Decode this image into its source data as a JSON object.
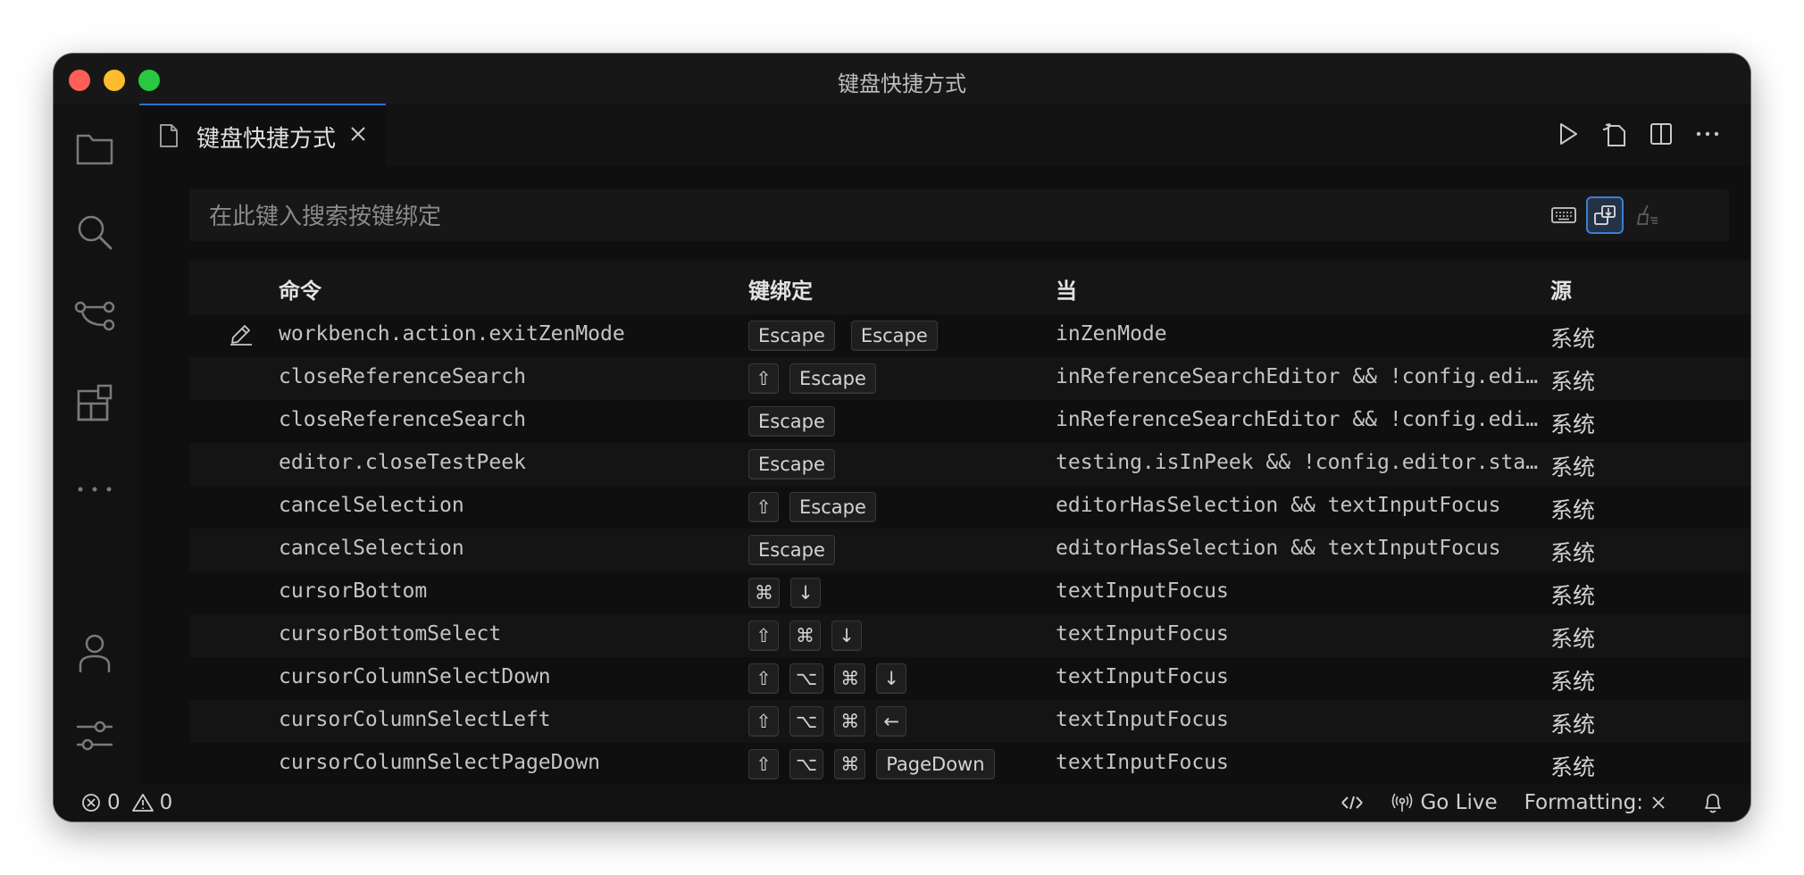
{
  "window": {
    "title": "键盘快捷方式"
  },
  "tab": {
    "label": "键盘快捷方式"
  },
  "search": {
    "placeholder": "在此键入搜索按键绑定"
  },
  "columns": {
    "command": "命令",
    "keybinding": "键绑定",
    "when": "当",
    "source": "源"
  },
  "rows": [
    {
      "command": "workbench.action.exitZenMode",
      "keys": [
        [
          "Escape"
        ],
        [
          "Escape"
        ]
      ],
      "when": "inZenMode",
      "source": "系统"
    },
    {
      "command": "closeReferenceSearch",
      "keys": [
        [
          "⇧",
          "Escape"
        ]
      ],
      "when": "inReferenceSearchEditor && !config.editor.stablePeek",
      "source": "系统"
    },
    {
      "command": "closeReferenceSearch",
      "keys": [
        [
          "Escape"
        ]
      ],
      "when": "inReferenceSearchEditor && !config.editor.stablePeek",
      "source": "系统"
    },
    {
      "command": "editor.closeTestPeek",
      "keys": [
        [
          "Escape"
        ]
      ],
      "when": "testing.isInPeek && !config.editor.stablePeek",
      "source": "系统"
    },
    {
      "command": "cancelSelection",
      "keys": [
        [
          "⇧",
          "Escape"
        ]
      ],
      "when": "editorHasSelection && textInputFocus",
      "source": "系统"
    },
    {
      "command": "cancelSelection",
      "keys": [
        [
          "Escape"
        ]
      ],
      "when": "editorHasSelection && textInputFocus",
      "source": "系统"
    },
    {
      "command": "cursorBottom",
      "keys": [
        [
          "⌘",
          "↓"
        ]
      ],
      "when": "textInputFocus",
      "source": "系统"
    },
    {
      "command": "cursorBottomSelect",
      "keys": [
        [
          "⇧",
          "⌘",
          "↓"
        ]
      ],
      "when": "textInputFocus",
      "source": "系统"
    },
    {
      "command": "cursorColumnSelectDown",
      "keys": [
        [
          "⇧",
          "⌥",
          "⌘",
          "↓"
        ]
      ],
      "when": "textInputFocus",
      "source": "系统"
    },
    {
      "command": "cursorColumnSelectLeft",
      "keys": [
        [
          "⇧",
          "⌥",
          "⌘",
          "←"
        ]
      ],
      "when": "textInputFocus",
      "source": "系统"
    },
    {
      "command": "cursorColumnSelectPageDown",
      "keys": [
        [
          "⇧",
          "⌥",
          "⌘",
          "PageDown"
        ]
      ],
      "when": "textInputFocus",
      "source": "系统"
    }
  ],
  "status": {
    "errors": "0",
    "warnings": "0",
    "go_live": "Go Live",
    "formatting": "Formatting:"
  },
  "colors": {
    "accent": "#3a7fd6",
    "background": "#0f0f0f"
  },
  "icons": {
    "activity": [
      "files-icon",
      "search-icon",
      "source-control-icon",
      "extensions-icon",
      "more-icon",
      "account-icon",
      "settings-icon"
    ],
    "editor_actions": [
      "run-icon",
      "open-json-icon",
      "split-editor-icon",
      "more-actions-icon"
    ],
    "search_actions": [
      "record-keys-icon",
      "sort-by-precedence-icon",
      "clear-search-icon"
    ]
  }
}
